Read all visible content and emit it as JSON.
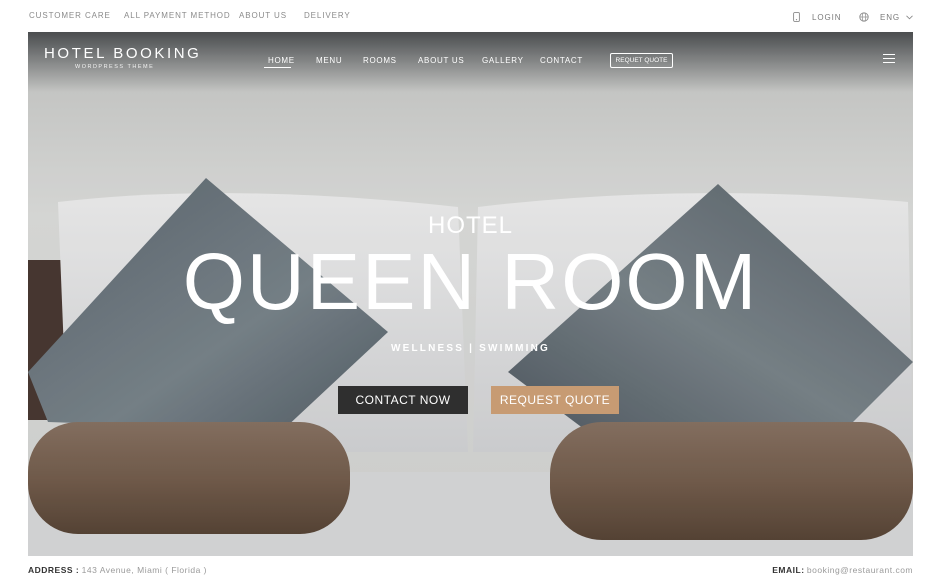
{
  "topbar": {
    "links": [
      "CUSTOMER CARE",
      "ALL PAYMENT METHOD",
      "ABOUT US",
      "DELIVERY"
    ],
    "login": "LOGIN",
    "language": "ENG"
  },
  "brand": {
    "title": "HOTEL BOOKING",
    "subtitle": "WORDPRESS THEME"
  },
  "nav": {
    "items": [
      "HOME",
      "MENU",
      "ROOMS",
      "ABOUT US",
      "GALLERY",
      "CONTACT"
    ],
    "active": "HOME",
    "quote_button": "REQUET QUOTE"
  },
  "hero": {
    "kicker": "HOTEL",
    "title": "QUEEN ROOM",
    "tags": "WELLNESS | SWIMMING",
    "contact_button": "CONTACT NOW",
    "quote_button": "REQUEST QUOTE"
  },
  "footer": {
    "address_label": "ADDRESS :",
    "address_value": "143 Avenue, Miami ( Florida )",
    "email_label": "EMAIL:",
    "email_value": "booking@restaurant.com"
  },
  "colors": {
    "accent": "#c79b73",
    "dark_button": "#2f2f2f"
  },
  "icons": [
    "phone-icon",
    "globe-icon",
    "chevron-down-icon",
    "menu-icon"
  ]
}
